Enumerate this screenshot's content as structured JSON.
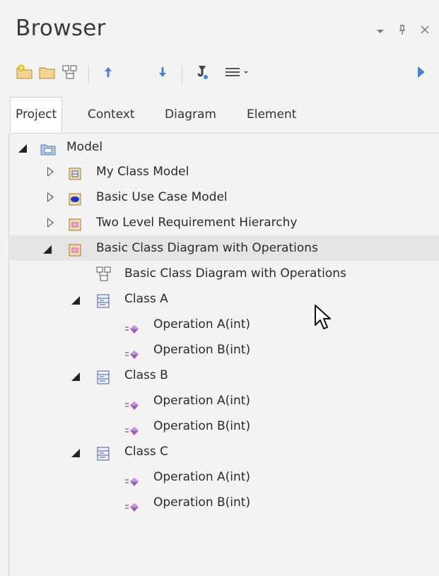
{
  "window": {
    "title": "Browser",
    "controls": [
      "chevron-down-icon",
      "pin-icon",
      "close-icon"
    ],
    "control_glyphs": [
      "▾",
      "ᵖ",
      "✕"
    ]
  },
  "toolbar": {
    "buttons": [
      "new-package-icon",
      "folder-icon",
      "diagram-icon",
      "move-up-icon",
      "move-down-icon",
      "locate-icon",
      "menu-icon",
      "run-icon"
    ]
  },
  "tabs": [
    "Project",
    "Context",
    "Diagram",
    "Element"
  ],
  "active_tab": "Project",
  "tree": {
    "root": "Model",
    "packages": [
      {
        "label": "My Class Model",
        "expanded": false
      },
      {
        "label": "Basic Use Case Model",
        "expanded": false
      },
      {
        "label": "Two Level Requirement Hierarchy",
        "expanded": false
      },
      {
        "label": "Basic Class Diagram with Operations",
        "expanded": true
      }
    ],
    "diagram": "Basic Class Diagram with Operations",
    "classes": [
      {
        "label": "Class A",
        "operations": [
          "Operation A(int)",
          "Operation B(int)"
        ]
      },
      {
        "label": "Class B",
        "operations": [
          "Operation A(int)",
          "Operation B(int)"
        ]
      },
      {
        "label": "Class C",
        "operations": [
          "Operation A(int)",
          "Operation B(int)"
        ]
      }
    ]
  },
  "colors": {
    "accent_arrow": "#4a7fd6",
    "package_pink": "#f0a7d6",
    "operation_purple": "#9c5bb8",
    "selection": "#e5e5e5"
  }
}
